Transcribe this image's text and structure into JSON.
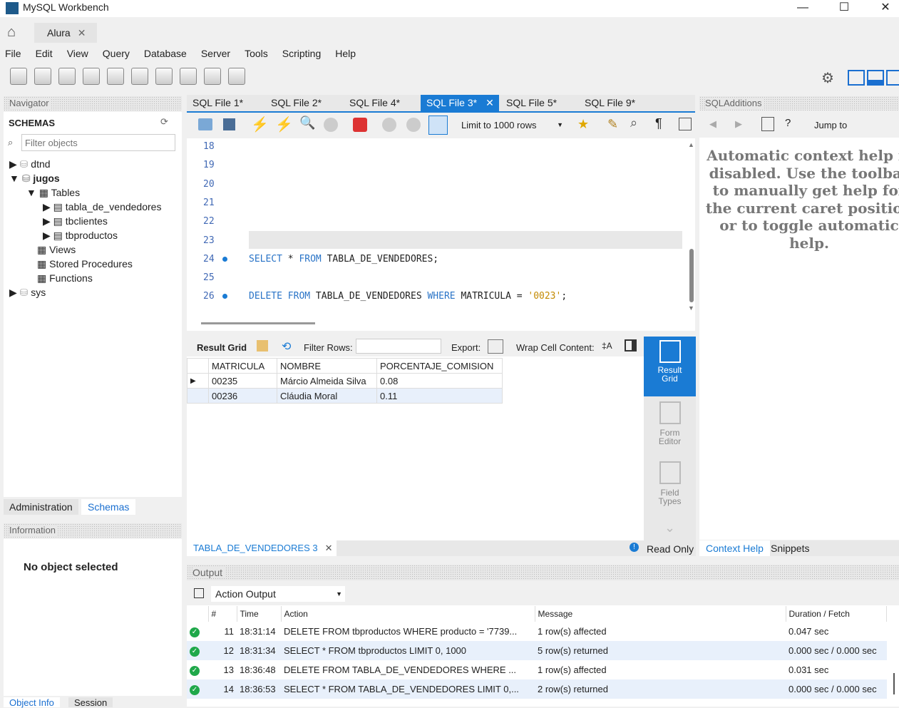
{
  "window": {
    "title": "MySQL Workbench"
  },
  "tabs": {
    "home": "home-icon",
    "connection": "Alura"
  },
  "menu": [
    "File",
    "Edit",
    "View",
    "Query",
    "Database",
    "Server",
    "Tools",
    "Scripting",
    "Help"
  ],
  "navigator": {
    "title": "Navigator",
    "schemas_label": "SCHEMAS",
    "filter_placeholder": "Filter objects",
    "tree": {
      "dtnd": "dtnd",
      "jugos": "jugos",
      "tables": "Tables",
      "t1": "tabla_de_vendedores",
      "t2": "tbclientes",
      "t3": "tbproductos",
      "views": "Views",
      "sp": "Stored Procedures",
      "fn": "Functions",
      "sys": "sys"
    },
    "tabs": [
      "Administration",
      "Schemas"
    ],
    "info_title": "Information",
    "no_object": "No object selected",
    "bottom_tabs": [
      "Object Info",
      "Session"
    ]
  },
  "editor": {
    "tabs": [
      "SQL File 1*",
      "SQL File 2*",
      "SQL File 4*",
      "SQL File 3*",
      "SQL File 5*",
      "SQL File 9*"
    ],
    "active_tab": 3,
    "limit": "Limit to 1000 rows",
    "lines": [
      "18",
      "19",
      "20",
      "21",
      "22",
      "23",
      "24",
      "25",
      "26"
    ],
    "line24": {
      "kw1": "SELECT",
      "rest1": " * ",
      "kw2": "FROM",
      "rest2": " TABLA_DE_VENDEDORES;"
    },
    "line26": {
      "kw1": "DELETE",
      "sp": " ",
      "kw2": "FROM",
      "rest1": " TABLA_DE_VENDEDORES ",
      "kw3": "WHERE",
      "rest2": " MATRICULA = ",
      "str": "'0023'",
      "end": ";"
    }
  },
  "result": {
    "grid_label": "Result Grid",
    "filter_label": "Filter Rows:",
    "export_label": "Export:",
    "wrap_label": "Wrap Cell Content:",
    "columns": [
      "MATRICULA",
      "NOMBRE",
      "PORCENTAJE_COMISION"
    ],
    "rows": [
      [
        "00235",
        "Márcio Almeida Silva",
        "0.08"
      ],
      [
        "00236",
        "Cláudia Moral",
        "0.11"
      ]
    ],
    "side": [
      "Result Grid",
      "Form Editor",
      "Field Types"
    ],
    "tab": "TABLA_DE_VENDEDORES 3",
    "readonly": "Read Only"
  },
  "additions": {
    "title": "SQLAdditions",
    "jump": "Jump to",
    "help": "Automatic context help is disabled. Use the toolbar to manually get help for the current caret position or to toggle automatic help.",
    "tabs": [
      "Context Help",
      "Snippets"
    ]
  },
  "output": {
    "title": "Output",
    "selector": "Action Output",
    "columns": [
      "#",
      "Time",
      "Action",
      "Message",
      "Duration / Fetch"
    ],
    "rows": [
      [
        "11",
        "18:31:14",
        "DELETE FROM tbproductos WHERE producto = '7739...",
        "1 row(s) affected",
        "0.047 sec"
      ],
      [
        "12",
        "18:31:34",
        "SELECT * FROM tbproductos LIMIT 0, 1000",
        "5 row(s) returned",
        "0.000 sec / 0.000 sec"
      ],
      [
        "13",
        "18:36:48",
        "DELETE FROM TABLA_DE_VENDEDORES WHERE ...",
        "1 row(s) affected",
        "0.031 sec"
      ],
      [
        "14",
        "18:36:53",
        "SELECT * FROM TABLA_DE_VENDEDORES LIMIT 0,...",
        "2 row(s) returned",
        "0.000 sec / 0.000 sec"
      ]
    ]
  },
  "colors": {
    "accent": "#0a7fd6",
    "keyword": "#2a74c7",
    "string": "#c48a00",
    "ok": "#1fa84a"
  }
}
